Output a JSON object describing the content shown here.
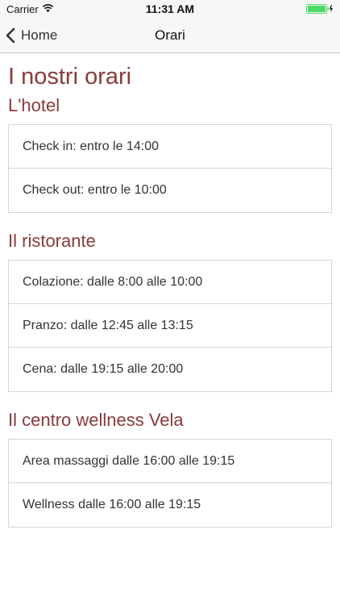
{
  "status_bar": {
    "carrier": "Carrier",
    "time": "11:31 AM",
    "battery_color": "#4cd964"
  },
  "nav": {
    "back_label": "Home",
    "title": "Orari"
  },
  "page": {
    "title": "I nostri orari",
    "accent_color": "#8b3a3a"
  },
  "sections": [
    {
      "title": "L'hotel",
      "items": [
        "Check in: entro le 14:00",
        "Check out: entro le 10:00"
      ]
    },
    {
      "title": "Il ristorante",
      "items": [
        "Colazione: dalle 8:00 alle 10:00",
        "Pranzo: dalle 12:45 alle 13:15",
        "Cena: dalle 19:15 alle 20:00"
      ]
    },
    {
      "title": "Il centro wellness Vela",
      "items": [
        "Area massaggi dalle 16:00 alle 19:15",
        "Wellness dalle 16:00 alle 19:15"
      ]
    }
  ]
}
